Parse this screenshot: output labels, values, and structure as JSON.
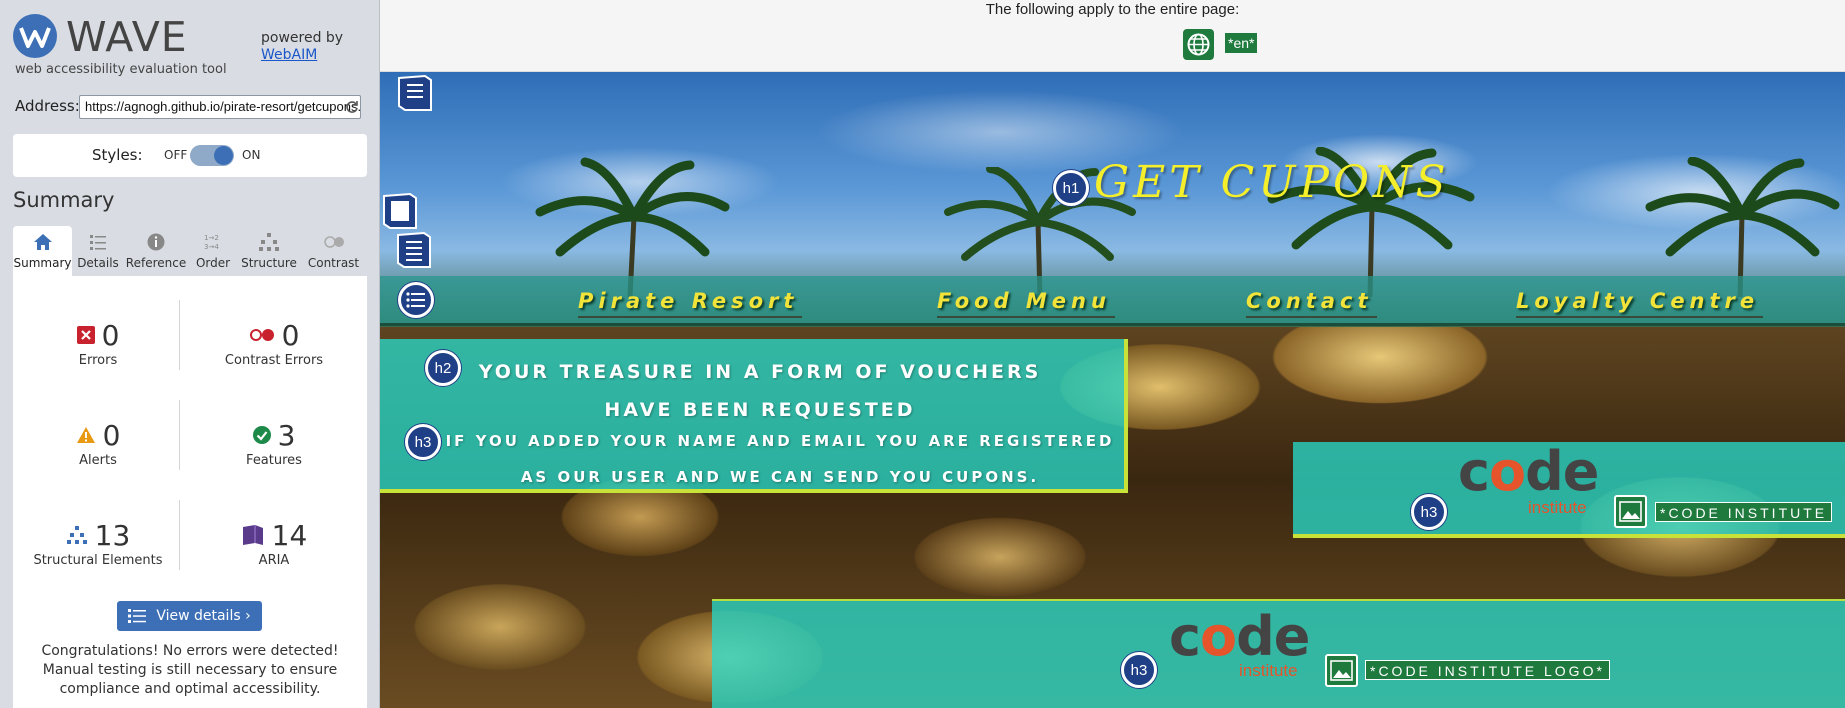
{
  "wave": {
    "logo_text": "WAVE",
    "tagline": "web accessibility evaluation tool",
    "powered_by": "powered by",
    "webaim_link": "WebAIM",
    "address_label": "Address:",
    "address_value": "https://agnogh.github.io/pirate-resort/getcupons.html",
    "styles_label": "Styles:",
    "styles_off": "OFF",
    "styles_on": "ON",
    "summary_title": "Summary",
    "tabs": [
      {
        "label": "Summary",
        "icon": "home-icon"
      },
      {
        "label": "Details",
        "icon": "list-icon"
      },
      {
        "label": "Reference",
        "icon": "info-icon"
      },
      {
        "label": "Order",
        "icon": "order-icon"
      },
      {
        "label": "Structure",
        "icon": "structure-icon"
      },
      {
        "label": "Contrast",
        "icon": "contrast-icon"
      }
    ],
    "stats": {
      "errors": {
        "value": "0",
        "label": "Errors"
      },
      "contrast_errors": {
        "value": "0",
        "label": "Contrast Errors"
      },
      "alerts": {
        "value": "0",
        "label": "Alerts"
      },
      "features": {
        "value": "3",
        "label": "Features"
      },
      "structural": {
        "value": "13",
        "label": "Structural Elements"
      },
      "aria": {
        "value": "14",
        "label": "ARIA"
      }
    },
    "view_details": "View details ›",
    "congrats": "Congratulations! No errors were detected! Manual testing is still necessary to ensure compliance and optimal accessibility."
  },
  "page": {
    "note": "The following apply to the entire page:",
    "lang": "*en*",
    "hero_title": "GET CUPONS",
    "nav": [
      "Pirate Resort",
      "Food Menu",
      "Contact",
      "Loyalty Centre"
    ],
    "h2": "YOUR TREASURE IN A FORM OF VOUCHERS HAVE BEEN REQUESTED",
    "h3": "IF YOU ADDED YOUR NAME AND EMAIL YOU ARE REGISTERED AS OUR USER AND WE CAN SEND YOU CUPONS.",
    "logo_word": "code",
    "logo_sub": "institute",
    "alt_short": "*CODE INSTITUTE",
    "alt_full": "*CODE INSTITUTE LOGO*",
    "heading_badges": {
      "h1": "h1",
      "h2": "h2",
      "h3": "h3"
    }
  },
  "colors": {
    "wave_blue": "#3c6fb6",
    "wave_green": "#1e7a3d",
    "heading_title": "#f4ef2a",
    "teal_box": "#28d7c8",
    "nav_text": "#f2e33a"
  }
}
